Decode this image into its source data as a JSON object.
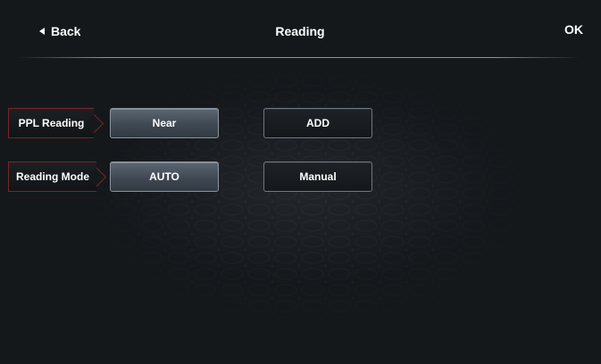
{
  "header": {
    "back_label": "Back",
    "title": "Reading",
    "ok_label": "OK"
  },
  "settings": [
    {
      "label": "PPL Reading",
      "options": [
        {
          "label": "Near",
          "selected": true
        },
        {
          "label": "ADD",
          "selected": false
        }
      ]
    },
    {
      "label": "Reading Mode",
      "options": [
        {
          "label": "AUTO",
          "selected": true
        },
        {
          "label": "Manual",
          "selected": false
        }
      ]
    }
  ],
  "colors": {
    "background": "#14181b",
    "label_border": "#7a2426",
    "selected_button": "#4a535d",
    "text": "#ffffff"
  },
  "icons": {
    "back": "left-triangle-icon"
  }
}
